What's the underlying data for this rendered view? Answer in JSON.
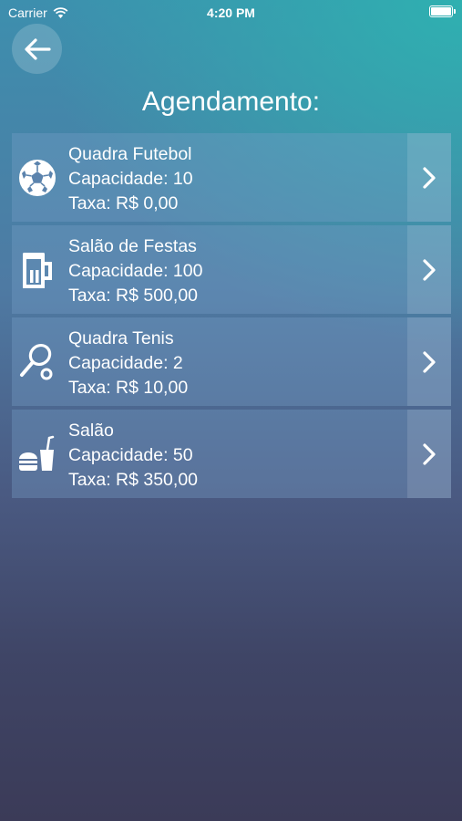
{
  "status_bar": {
    "carrier": "Carrier",
    "time": "4:20 PM",
    "battery_level": 1.0
  },
  "header": {
    "title": "Agendamento:"
  },
  "items": [
    {
      "icon": "soccer-ball-icon",
      "name": "Quadra Futebol",
      "capacity": "Capacidade: 10",
      "fee": "Taxa: R$ 0,00"
    },
    {
      "icon": "beer-mug-icon",
      "name": "Salão de Festas",
      "capacity": "Capacidade: 100",
      "fee": "Taxa: R$ 500,00"
    },
    {
      "icon": "tennis-racket-icon",
      "name": "Quadra Tenis",
      "capacity": "Capacidade: 2",
      "fee": "Taxa: R$ 10,00"
    },
    {
      "icon": "fast-food-icon",
      "name": "Salão",
      "capacity": "Capacidade: 50",
      "fee": "Taxa: R$ 350,00"
    }
  ]
}
